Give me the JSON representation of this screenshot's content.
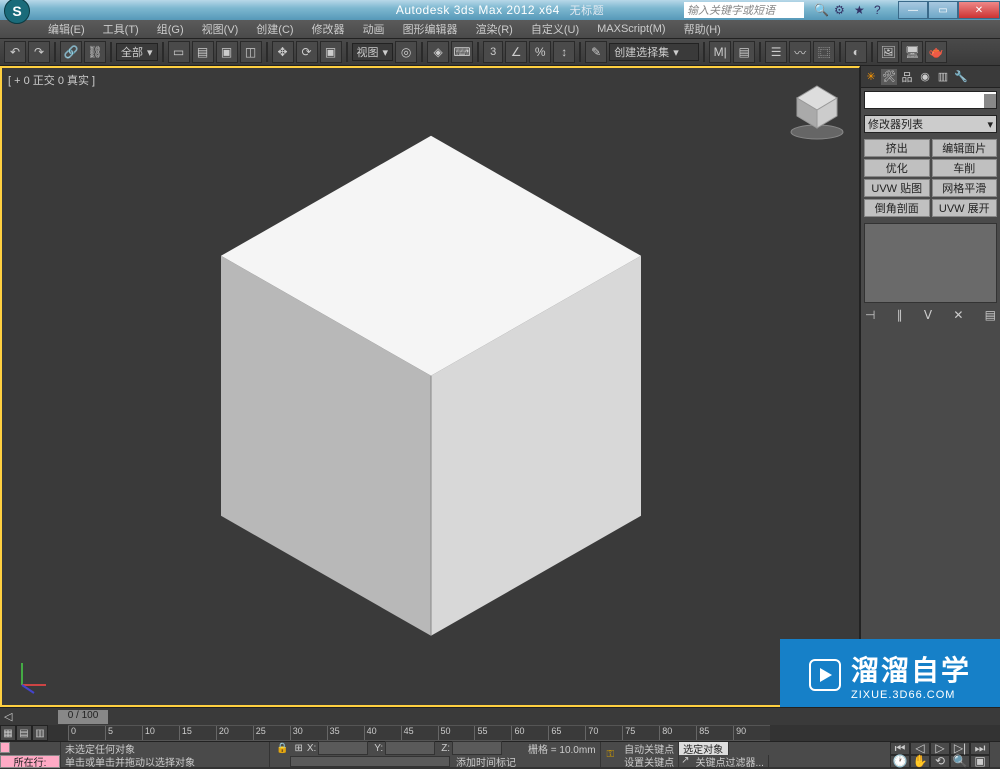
{
  "title": {
    "app": "Autodesk 3ds Max  2012 x64",
    "doc": "无标题",
    "search_placeholder": "输入关键字或短语"
  },
  "menu": {
    "items": [
      "编辑(E)",
      "工具(T)",
      "组(G)",
      "视图(V)",
      "创建(C)",
      "修改器",
      "动画",
      "图形编辑器",
      "渲染(R)",
      "自定义(U)",
      "MAXScript(M)",
      "帮助(H)"
    ]
  },
  "toolbar1": {
    "scope": "全部",
    "view_label": "视图",
    "num": "3",
    "selset": "创建选择集"
  },
  "viewport": {
    "label": "[ + 0 正交 0 真实 ]"
  },
  "sidepanel": {
    "modifier_list": "修改器列表",
    "grid": [
      "挤出",
      "编辑面片",
      "优化",
      "车削",
      "UVW 贴图",
      "网格平滑",
      "倒角剖面",
      "UVW 展开"
    ]
  },
  "timeline": {
    "frame": "0 / 100",
    "ticks": [
      "0",
      "5",
      "10",
      "15",
      "20",
      "25",
      "30",
      "35",
      "40",
      "45",
      "50",
      "55",
      "60",
      "65",
      "70",
      "75",
      "80",
      "85",
      "90"
    ]
  },
  "status": {
    "row_label": "所在行:",
    "msg1": "未选定任何对象",
    "msg2": "单击或单击并拖动以选择对象",
    "x": "X:",
    "y": "Y:",
    "z": "Z:",
    "grid": "栅格 = 10.0mm",
    "addmarker": "添加时间标记",
    "autokey": "自动关键点",
    "selobj": "选定对象",
    "setkey": "设置关键点",
    "keyfilter": "关键点过滤器..."
  },
  "watermark": {
    "brand": "溜溜自学",
    "url": "ZIXUE.3D66.COM"
  }
}
